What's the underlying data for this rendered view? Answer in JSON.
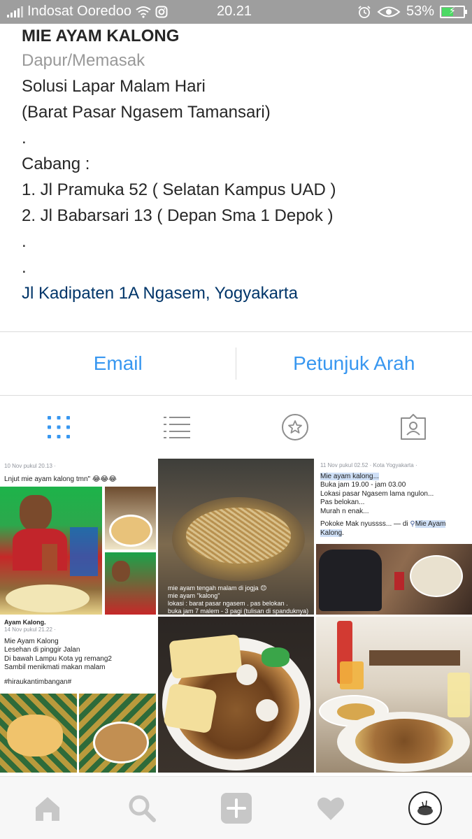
{
  "status_bar": {
    "carrier": "Indosat Ooredoo",
    "time": "20.21",
    "battery": "53%",
    "battery_level": 0.53
  },
  "profile": {
    "name": "MIE AYAM KALONG",
    "category": "Dapur/Memasak",
    "bio_lines": [
      "Solusi Lapar Malam Hari",
      "(Barat Pasar Ngasem Tamansari)",
      ".",
      "Cabang :",
      "1. Jl Pramuka 52 ( Selatan Kampus UAD )",
      "2. Jl Babarsari 13 ( Depan Sma 1 Depok )",
      ".",
      "."
    ],
    "address": "Jl Kadipaten 1A Ngasem, Yogyakarta"
  },
  "contact": {
    "email_label": "Email",
    "directions_label": "Petunjuk Arah"
  },
  "tabs": [
    "grid-icon",
    "list-icon",
    "saved-star-icon",
    "tagged-icon"
  ],
  "posts": [
    {
      "meta": "10 Nov pukul 20.13 · ",
      "text": "Lnjut mie ayam kalong tmn\" 😂😂😂"
    },
    {
      "caption_lines": [
        "mie ayam tengah malam di jogja 😊",
        "mie ayam \"kalong\"",
        "lokasi : barat pasar ngasem . pas belokan .",
        "buka jam 7 malem - 3 pagi (tulisan di spanduknya)"
      ]
    },
    {
      "meta": "11 Nov pukul 02.52 · Kota Yogyakarta · ",
      "lines": [
        "Mie ayam kalong...",
        "Buka jam 19.00 - jam 03.00",
        "Lokasi pasar Ngasem lama ngulon...",
        "Pas belokan...",
        "Murah n enak..."
      ],
      "tail": "Pokoke Mak nyussss... — di ",
      "place": "Mie Ayam Kalong",
      "end": "."
    },
    {
      "header": "Ayam Kalong.",
      "meta": "14 Nov pukul 21.22 · ",
      "lines": [
        "Mie Ayam Kalong",
        "Lesehan di pinggir Jalan",
        "Di bawah Lampu Kota yg remang2",
        "Sambil menikmati makan malam",
        "",
        "#hiraukantimbangan#"
      ]
    },
    {
      "label": ""
    },
    {
      "label": ""
    }
  ],
  "bottom_nav": [
    "home-icon",
    "search-icon",
    "add-post-icon",
    "activity-heart-icon",
    "profile-avatar-icon"
  ]
}
